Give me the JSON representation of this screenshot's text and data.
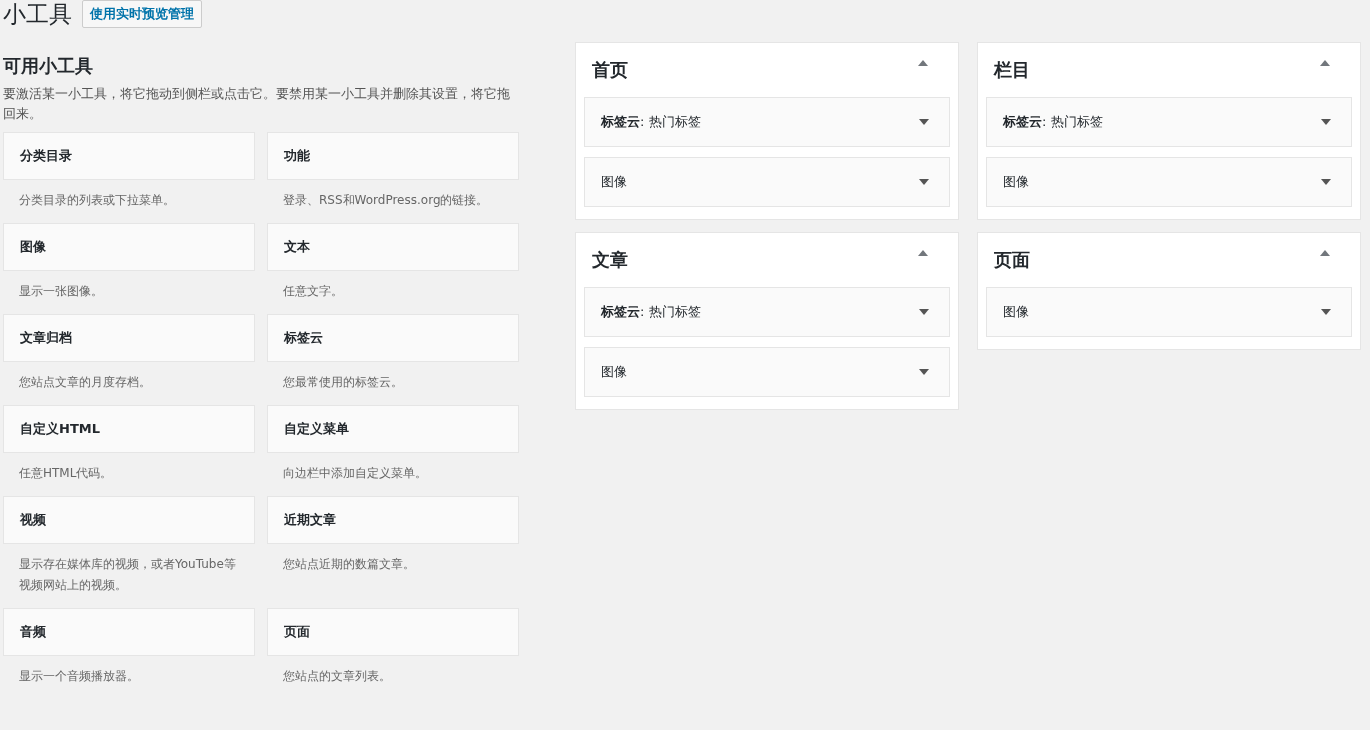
{
  "page": {
    "title": "小工具",
    "action_button": "使用实时预览管理"
  },
  "available": {
    "heading": "可用小工具",
    "description": "要激活某一小工具，将它拖动到侧栏或点击它。要禁用某一小工具并删除其设置，将它拖回来。",
    "widgets": [
      {
        "name": "分类目录",
        "description": "分类目录的列表或下拉菜单。"
      },
      {
        "name": "功能",
        "description": "登录、RSS和WordPress.org的链接。"
      },
      {
        "name": "图像",
        "description": "显示一张图像。"
      },
      {
        "name": "文本",
        "description": "任意文字。"
      },
      {
        "name": "文章归档",
        "description": "您站点文章的月度存档。"
      },
      {
        "name": "标签云",
        "description": "您最常使用的标签云。"
      },
      {
        "name": "自定义HTML",
        "description": "任意HTML代码。"
      },
      {
        "name": "自定义菜单",
        "description": "向边栏中添加自定义菜单。"
      },
      {
        "name": "视频",
        "description": "显示存在媒体库的视频，或者YouTube等视频网站上的视频。"
      },
      {
        "name": "近期文章",
        "description": "您站点近期的数篇文章。"
      },
      {
        "name": "音频",
        "description": "显示一个音频播放器。"
      },
      {
        "name": "页面",
        "description": "您站点的文章列表。"
      }
    ]
  },
  "sidebars": [
    {
      "title": "首页",
      "expanded": true,
      "widgets": [
        {
          "title": "**标签云**: 热门标签",
          "expanded": false
        },
        {
          "title": "图像",
          "expanded": false
        }
      ]
    },
    {
      "title": "栏目",
      "expanded": true,
      "widgets": [
        {
          "title": "**标签云**: 热门标签",
          "expanded": false
        },
        {
          "title": "图像",
          "expanded": false
        }
      ]
    },
    {
      "title": "文章",
      "expanded": true,
      "widgets": [
        {
          "title": "**标签云**: 热门标签",
          "expanded": false
        },
        {
          "title": "图像",
          "expanded": false
        }
      ]
    },
    {
      "title": "页面",
      "expanded": true,
      "widgets": [
        {
          "title": "图像",
          "expanded": false
        }
      ]
    }
  ]
}
